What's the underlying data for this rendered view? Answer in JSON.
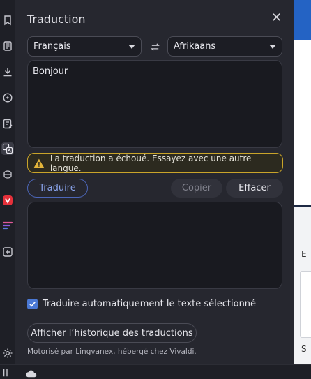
{
  "panel": {
    "title": "Traduction",
    "close_icon": "close-icon",
    "source_language": "Français",
    "target_language": "Afrikaans",
    "source_text": "Bonjour",
    "warning_text": "La traduction a échoué. Essayez avec une autre langue.",
    "translate_label": "Traduire",
    "copy_label": "Copier",
    "clear_label": "Effacer",
    "auto_translate_label": "Traduire automatiquement le texte sélectionné",
    "auto_translate_checked": true,
    "history_label": "Afficher l’historique des traductions",
    "footer": "Motorisé par Lingvanex, hébergé chez Vivaldi."
  },
  "sidebar_icons": [
    "bookmark-icon",
    "reading-list-icon",
    "downloads-icon",
    "history-icon",
    "notes-icon",
    "translate-icon",
    "window-icon",
    "vivaldi-icon",
    "feed-icon",
    "add-panel-icon",
    "settings-icon"
  ],
  "colors": {
    "accent": "#4a78d4",
    "warning_border": "#c9a42a",
    "vivaldi_red": "#e5303a"
  },
  "background_page": {
    "letter_1": "S",
    "letter_2": "E",
    "letter_3": "S"
  }
}
